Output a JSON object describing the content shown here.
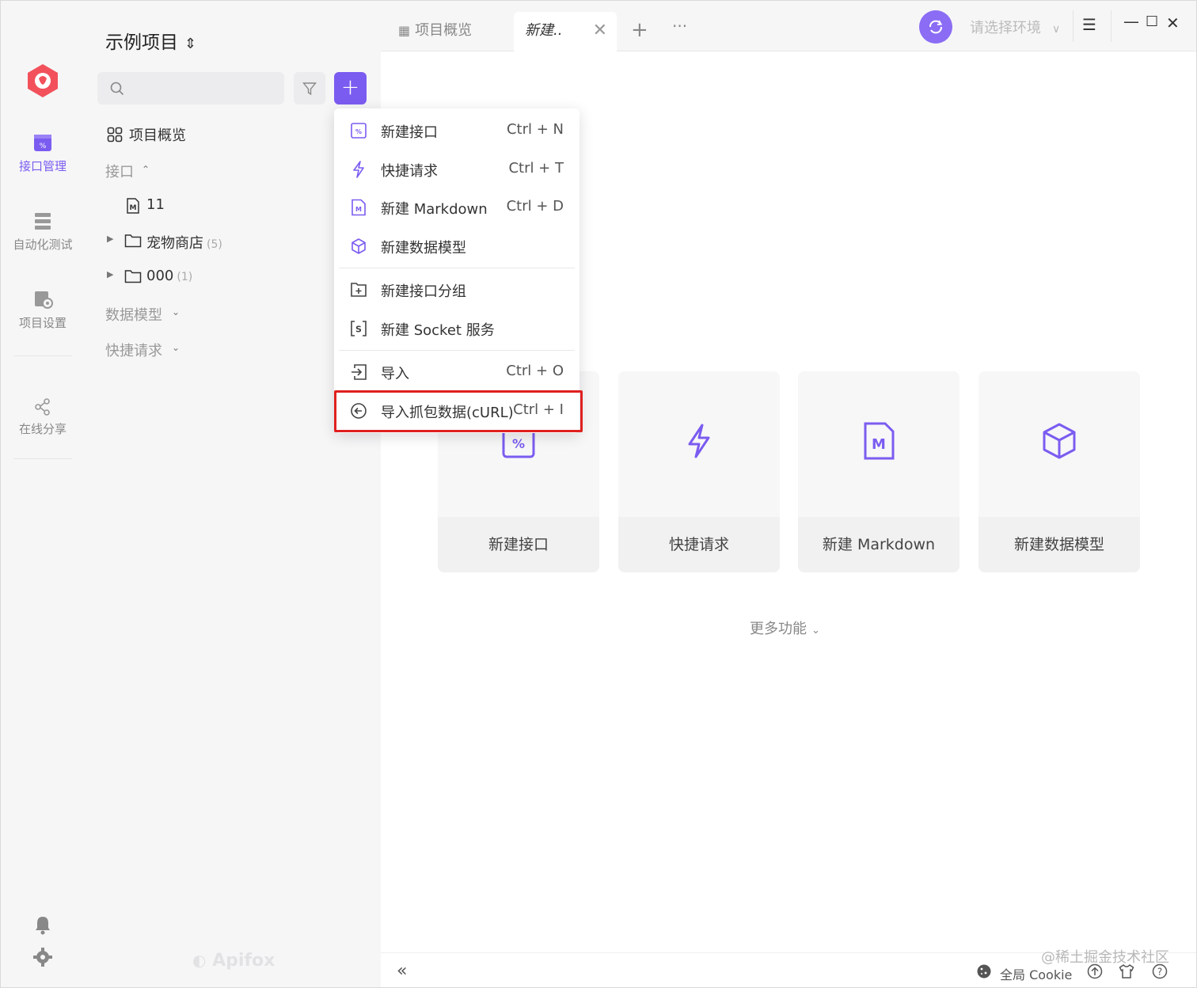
{
  "project": {
    "title": "示例项目"
  },
  "rail": {
    "items": [
      {
        "label": "接口管理",
        "icon": "api-icon",
        "active": true
      },
      {
        "label": "自动化测试",
        "icon": "automation-icon",
        "active": false
      },
      {
        "label": "项目设置",
        "icon": "settings-icon",
        "active": false
      },
      {
        "label": "在线分享",
        "icon": "share-icon",
        "active": false
      }
    ]
  },
  "sidebar": {
    "overview": "项目概览",
    "api_section": "接口",
    "api_item": "11",
    "folders": [
      {
        "name": "宠物商店",
        "count": "(5)"
      },
      {
        "name": "000",
        "count": "(1)"
      }
    ],
    "data_models": "数据模型",
    "quick_requests": "快捷请求",
    "watermark": "Apifox"
  },
  "tabs": [
    {
      "label": "项目概览",
      "active": false
    },
    {
      "label": "新建..",
      "active": true
    }
  ],
  "env": {
    "placeholder": "请选择环境"
  },
  "cards": [
    {
      "label": "新建接口",
      "icon": "api-icon"
    },
    {
      "label": "快捷请求",
      "icon": "lightning-icon"
    },
    {
      "label": "新建 Markdown",
      "icon": "markdown-icon"
    },
    {
      "label": "新建数据模型",
      "icon": "cube-icon"
    }
  ],
  "more": "更多功能",
  "dropdown": {
    "items": [
      {
        "label": "新建接口",
        "shortcut": "Ctrl + N",
        "icon": "api-icon"
      },
      {
        "label": "快捷请求",
        "shortcut": "Ctrl + T",
        "icon": "lightning-icon"
      },
      {
        "label": "新建 Markdown",
        "shortcut": "Ctrl + D",
        "icon": "markdown-icon"
      },
      {
        "label": "新建数据模型",
        "shortcut": "",
        "icon": "cube-icon"
      },
      {
        "label": "新建接口分组",
        "shortcut": "",
        "icon": "folder-add-icon"
      },
      {
        "label": "新建 Socket 服务",
        "shortcut": "",
        "icon": "socket-icon"
      },
      {
        "label": "导入",
        "shortcut": "Ctrl + O",
        "icon": "import-icon"
      },
      {
        "label": "导入抓包数据(cURL)",
        "shortcut": "Ctrl + I",
        "icon": "curl-icon"
      }
    ]
  },
  "statusbar": {
    "cookie": "全局 Cookie",
    "credit": "@稀土掘金技术社区"
  },
  "colors": {
    "accent": "#7b5cf0",
    "highlight": "#e02020"
  }
}
